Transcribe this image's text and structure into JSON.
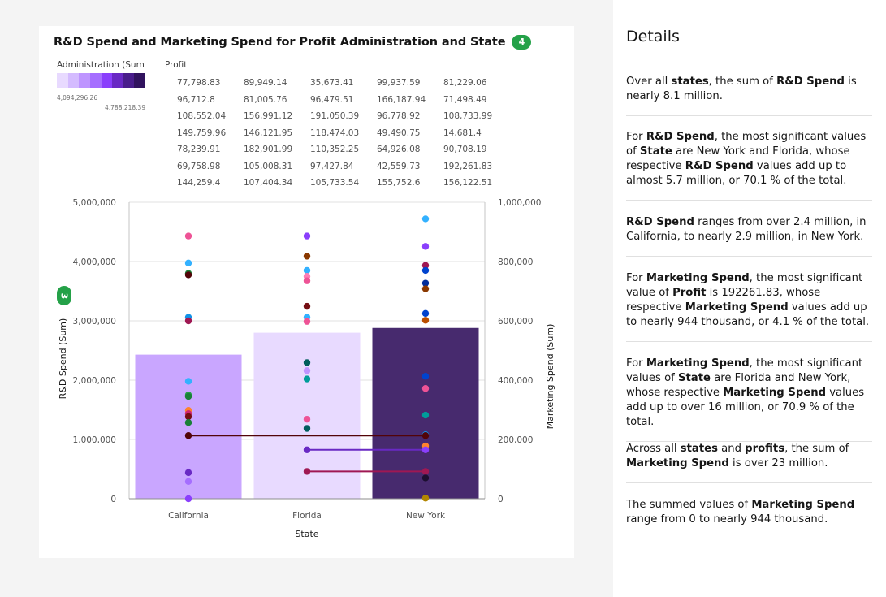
{
  "chart": {
    "title": "R&D Spend and Marketing Spend for Profit Administration and State",
    "badge_count": "4",
    "axis_badge_count": "3",
    "legend_admin_title": "Administration (Sum",
    "legend_admin_min": "4,094,296.26",
    "legend_admin_max": "4,788,218.39",
    "legend_admin_colors": [
      "#e8daff",
      "#d4bbff",
      "#be95ff",
      "#a56eff",
      "#8a3ffc",
      "#6929c4",
      "#491d8b",
      "#31135e"
    ],
    "legend_profit_title": "Profit",
    "profit_values": [
      "77,798.83",
      "89,949.14",
      "35,673.41",
      "99,937.59",
      "81,229.06",
      "96,712.8",
      "81,005.76",
      "96,479.51",
      "166,187.94",
      "71,498.49",
      "108,552.04",
      "156,991.12",
      "191,050.39",
      "96,778.92",
      "108,733.99",
      "149,759.96",
      "146,121.95",
      "118,474.03",
      "49,490.75",
      "14,681.4",
      "78,239.91",
      "182,901.99",
      "110,352.25",
      "64,926.08",
      "90,708.19",
      "69,758.98",
      "105,008.31",
      "97,427.84",
      "42,559.73",
      "192,261.83",
      "144,259.4",
      "107,404.34",
      "105,733.54",
      "155,752.6",
      "156,122.51"
    ]
  },
  "chart_data": {
    "type": "bar",
    "xlabel": "State",
    "ylabel": "R&D Spend (Sum)",
    "y2label": "Marketing Spend (Sum)",
    "categories": [
      "California",
      "Florida",
      "New York"
    ],
    "ylim": [
      0,
      5000000
    ],
    "y2lim": [
      0,
      1000000
    ],
    "yticks": [
      "0",
      "1,000,000",
      "2,000,000",
      "3,000,000",
      "4,000,000",
      "5,000,000"
    ],
    "y2ticks": [
      "0",
      "200,000",
      "400,000",
      "600,000",
      "800,000",
      "1,000,000"
    ],
    "bars": [
      {
        "category": "California",
        "value": 2430000,
        "color": "#c9a6ff"
      },
      {
        "category": "Florida",
        "value": 2800000,
        "color": "#e8daff"
      },
      {
        "category": "New York",
        "value": 2880000,
        "color": "#472a6e"
      }
    ],
    "points": [
      {
        "category": "California",
        "value": 886000,
        "color": "#ee5396"
      },
      {
        "category": "California",
        "value": 795000,
        "color": "#33b1ff"
      },
      {
        "category": "California",
        "value": 760000,
        "color": "#198038"
      },
      {
        "category": "California",
        "value": 755000,
        "color": "#520408"
      },
      {
        "category": "California",
        "value": 612000,
        "color": "#1192e8"
      },
      {
        "category": "California",
        "value": 600000,
        "color": "#9f1853"
      },
      {
        "category": "California",
        "value": 396000,
        "color": "#33b1ff"
      },
      {
        "category": "California",
        "value": 350000,
        "color": "#24a148"
      },
      {
        "category": "California",
        "value": 345000,
        "color": "#198038"
      },
      {
        "category": "California",
        "value": 298000,
        "color": "#ff832b"
      },
      {
        "category": "California",
        "value": 287000,
        "color": "#d02670"
      },
      {
        "category": "California",
        "value": 277000,
        "color": "#750e13"
      },
      {
        "category": "California",
        "value": 257000,
        "color": "#198038"
      },
      {
        "category": "California",
        "value": 213000,
        "color": "#520408"
      },
      {
        "category": "California",
        "value": 91000,
        "color": "#be95ff"
      },
      {
        "category": "California",
        "value": 88000,
        "color": "#6929c4"
      },
      {
        "category": "California",
        "value": 58000,
        "color": "#a56eff"
      },
      {
        "category": "California",
        "value": 0,
        "color": "#8a3ffc"
      },
      {
        "category": "Florida",
        "value": 886000,
        "color": "#8a3ffc"
      },
      {
        "category": "Florida",
        "value": 818000,
        "color": "#8a3800"
      },
      {
        "category": "Florida",
        "value": 770000,
        "color": "#33b1ff"
      },
      {
        "category": "Florida",
        "value": 750000,
        "color": "#ff7eb6"
      },
      {
        "category": "Florida",
        "value": 735000,
        "color": "#ee5396"
      },
      {
        "category": "Florida",
        "value": 649000,
        "color": "#750e13"
      },
      {
        "category": "Florida",
        "value": 612000,
        "color": "#33b1ff"
      },
      {
        "category": "Florida",
        "value": 598000,
        "color": "#ee5396"
      },
      {
        "category": "Florida",
        "value": 459000,
        "color": "#005d5d"
      },
      {
        "category": "Florida",
        "value": 432000,
        "color": "#be95ff"
      },
      {
        "category": "Florida",
        "value": 404000,
        "color": "#009d9a"
      },
      {
        "category": "Florida",
        "value": 268000,
        "color": "#ee5396"
      },
      {
        "category": "Florida",
        "value": 237000,
        "color": "#005d5d"
      },
      {
        "category": "Florida",
        "value": 165000,
        "color": "#6929c4"
      },
      {
        "category": "Florida",
        "value": 92000,
        "color": "#9f1853"
      },
      {
        "category": "New York",
        "value": 944000,
        "color": "#33b1ff"
      },
      {
        "category": "New York",
        "value": 851000,
        "color": "#8a3ffc"
      },
      {
        "category": "New York",
        "value": 787000,
        "color": "#9f1853"
      },
      {
        "category": "New York",
        "value": 770000,
        "color": "#0043ce"
      },
      {
        "category": "New York",
        "value": 727000,
        "color": "#002d9c"
      },
      {
        "category": "New York",
        "value": 708000,
        "color": "#8a3800"
      },
      {
        "category": "New York",
        "value": 625000,
        "color": "#0043ce"
      },
      {
        "category": "New York",
        "value": 602000,
        "color": "#ba4e00"
      },
      {
        "category": "New York",
        "value": 413000,
        "color": "#0043ce"
      },
      {
        "category": "New York",
        "value": 372000,
        "color": "#ee5396"
      },
      {
        "category": "New York",
        "value": 282000,
        "color": "#009d9a"
      },
      {
        "category": "New York",
        "value": 216000,
        "color": "#1192e8"
      },
      {
        "category": "New York",
        "value": 213000,
        "color": "#520408"
      },
      {
        "category": "New York",
        "value": 178000,
        "color": "#ff832b"
      },
      {
        "category": "New York",
        "value": 165000,
        "color": "#8a3ffc"
      },
      {
        "category": "New York",
        "value": 92000,
        "color": "#9f1853"
      },
      {
        "category": "New York",
        "value": 70000,
        "color": "#1c0f30"
      },
      {
        "category": "New York",
        "value": 2000,
        "color": "#b28600"
      }
    ],
    "lines": [
      {
        "color": "#520408",
        "values": [
          213000,
          213000,
          213000
        ]
      },
      {
        "color": "#6929c4",
        "values": [
          null,
          165000,
          165000
        ]
      },
      {
        "color": "#9f1853",
        "values": [
          null,
          92000,
          92000
        ]
      }
    ]
  },
  "details": {
    "title": "Details",
    "insights": [
      [
        {
          "t": "Over all "
        },
        {
          "b": "states"
        },
        {
          "t": ", the sum of "
        },
        {
          "b": "R&D Spend"
        },
        {
          "t": " is nearly 8.1 million."
        }
      ],
      [
        {
          "t": "For "
        },
        {
          "b": "R&D Spend"
        },
        {
          "t": ", the most significant values of "
        },
        {
          "b": "State"
        },
        {
          "t": " are New York and Florida, whose respective "
        },
        {
          "b": "R&D Spend"
        },
        {
          "t": " values add up to almost 5.7 million, or 70.1 % of the total."
        }
      ],
      [
        {
          "b": "R&D Spend"
        },
        {
          "t": " ranges from over 2.4 million, in California, to nearly 2.9 million, in New York."
        }
      ],
      [
        {
          "t": "For "
        },
        {
          "b": "Marketing Spend"
        },
        {
          "t": ", the most significant value of "
        },
        {
          "b": "Profit"
        },
        {
          "t": " is 192261.83, whose respective "
        },
        {
          "b": "Marketing Spend"
        },
        {
          "t": " values add up to nearly 944 thousand, or 4.1 % of the total."
        }
      ],
      [
        {
          "t": "For "
        },
        {
          "b": "Marketing Spend"
        },
        {
          "t": ", the most significant values of "
        },
        {
          "b": "State"
        },
        {
          "t": " are Florida and New York, whose respective "
        },
        {
          "b": "Marketing Spend"
        },
        {
          "t": " values add up to over 16 million, or 70.9 % of the total."
        }
      ],
      [
        {
          "t": "Across all "
        },
        {
          "b": "states"
        },
        {
          "t": " and "
        },
        {
          "b": "profits"
        },
        {
          "t": ", the sum of "
        },
        {
          "b": "Marketing Spend"
        },
        {
          "t": " is over 23 million."
        }
      ],
      [
        {
          "t": "The summed values of "
        },
        {
          "b": "Marketing Spend"
        },
        {
          "t": " range from 0 to nearly 944 thousand."
        }
      ]
    ]
  }
}
